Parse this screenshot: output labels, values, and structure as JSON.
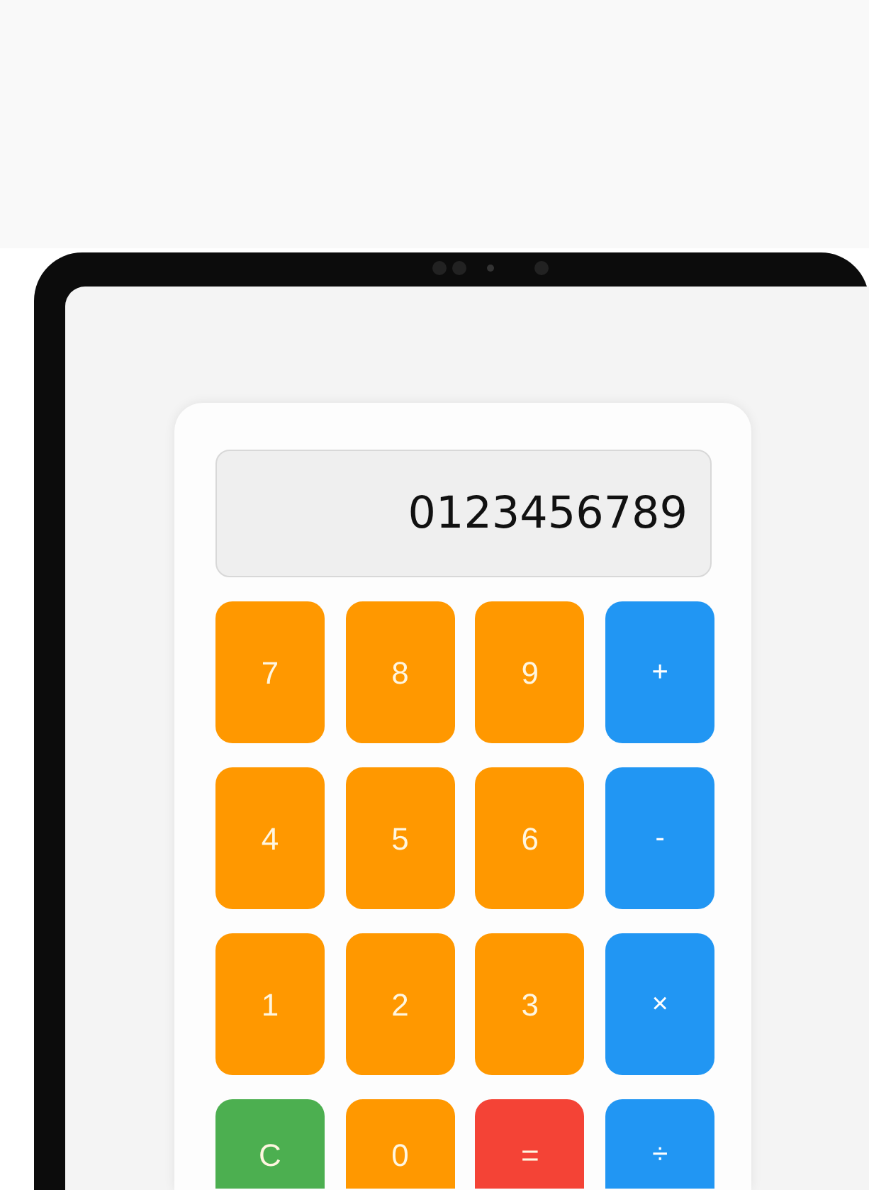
{
  "display": {
    "value": "0123456789"
  },
  "keys": [
    {
      "label": "7",
      "kind": "digit"
    },
    {
      "label": "8",
      "kind": "digit"
    },
    {
      "label": "9",
      "kind": "digit"
    },
    {
      "label": "+",
      "kind": "operator"
    },
    {
      "label": "4",
      "kind": "digit"
    },
    {
      "label": "5",
      "kind": "digit"
    },
    {
      "label": "6",
      "kind": "digit"
    },
    {
      "label": "-",
      "kind": "operator"
    },
    {
      "label": "1",
      "kind": "digit"
    },
    {
      "label": "2",
      "kind": "digit"
    },
    {
      "label": "3",
      "kind": "digit"
    },
    {
      "label": "×",
      "kind": "operator"
    },
    {
      "label": "C",
      "kind": "clear"
    },
    {
      "label": "0",
      "kind": "digit"
    },
    {
      "label": "=",
      "kind": "equals"
    },
    {
      "label": "÷",
      "kind": "operator"
    }
  ]
}
